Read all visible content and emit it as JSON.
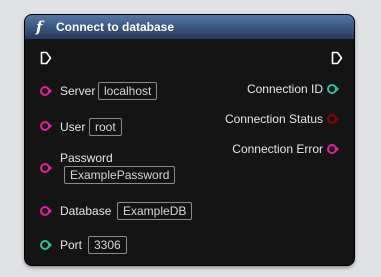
{
  "node": {
    "title": "Connect to database",
    "function_icon": "f",
    "colors": {
      "header": "#3e5a85",
      "body": "#141414",
      "string_pin": "#e0219e",
      "integer_pin": "#2ac09a",
      "boolean_pin": "#8c0000",
      "exec_pin": "#ffffff"
    },
    "inputs": [
      {
        "label": "Server",
        "value": "localhost",
        "pin": "string"
      },
      {
        "label": "User",
        "value": "root",
        "pin": "string"
      },
      {
        "label": "Password",
        "value": "ExamplePassword",
        "pin": "string"
      },
      {
        "label": "Database",
        "value": "ExampleDB",
        "pin": "string"
      },
      {
        "label": "Port",
        "value": "3306",
        "pin": "integer"
      }
    ],
    "outputs": [
      {
        "label": "Connection ID",
        "pin": "integer"
      },
      {
        "label": "Connection Status",
        "pin": "boolean"
      },
      {
        "label": "Connection Error",
        "pin": "string"
      }
    ]
  }
}
